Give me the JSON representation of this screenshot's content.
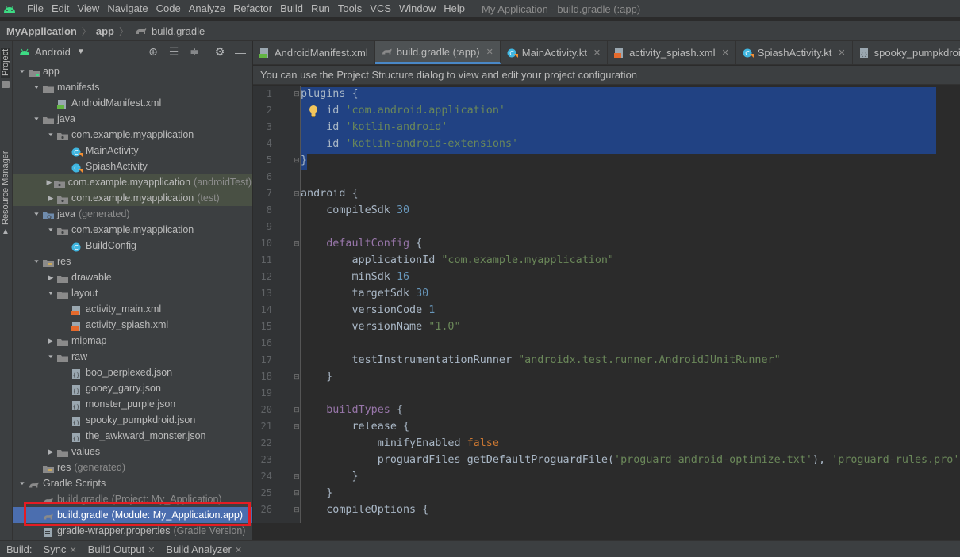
{
  "menubar": {
    "items": [
      "File",
      "Edit",
      "View",
      "Navigate",
      "Code",
      "Analyze",
      "Refactor",
      "Build",
      "Run",
      "Tools",
      "VCS",
      "Window",
      "Help"
    ],
    "window_title": "My Application - build.gradle (:app)"
  },
  "breadcrumb": {
    "project": "MyApplication",
    "module": "app",
    "file": "build.gradle"
  },
  "toolstrip": {
    "project_tab": "Project",
    "resource_manager_tab": "Resource Manager"
  },
  "project_panel": {
    "view_mode": "Android",
    "tree": [
      {
        "label": "app",
        "depth": 0,
        "arrow": "down",
        "icon": "module-folder-icon",
        "bold": false
      },
      {
        "label": "manifests",
        "depth": 1,
        "arrow": "down",
        "icon": "folder-icon"
      },
      {
        "label": "AndroidManifest.xml",
        "depth": 2,
        "arrow": "",
        "icon": "manifest-file-icon"
      },
      {
        "label": "java",
        "depth": 1,
        "arrow": "down",
        "icon": "folder-icon"
      },
      {
        "label": "com.example.myapplication",
        "depth": 2,
        "arrow": "down",
        "icon": "package-icon"
      },
      {
        "label": "MainActivity",
        "depth": 3,
        "arrow": "",
        "icon": "kotlin-class-icon"
      },
      {
        "label": "SpiashActivity",
        "depth": 3,
        "arrow": "",
        "icon": "kotlin-class-icon"
      },
      {
        "label": "com.example.myapplication",
        "sub": "(androidTest)",
        "depth": 2,
        "arrow": "right",
        "icon": "package-icon",
        "style": "hl-green"
      },
      {
        "label": "com.example.myapplication",
        "sub": "(test)",
        "depth": 2,
        "arrow": "right",
        "icon": "package-icon",
        "style": "hl-green"
      },
      {
        "label": "java",
        "sub": "(generated)",
        "depth": 1,
        "arrow": "down",
        "icon": "generated-folder-icon"
      },
      {
        "label": "com.example.myapplication",
        "depth": 2,
        "arrow": "down",
        "icon": "package-icon"
      },
      {
        "label": "BuildConfig",
        "depth": 3,
        "arrow": "",
        "icon": "java-class-icon"
      },
      {
        "label": "res",
        "depth": 1,
        "arrow": "down",
        "icon": "res-folder-icon"
      },
      {
        "label": "drawable",
        "depth": 2,
        "arrow": "right",
        "icon": "folder-icon"
      },
      {
        "label": "layout",
        "depth": 2,
        "arrow": "down",
        "icon": "folder-icon"
      },
      {
        "label": "activity_main.xml",
        "depth": 3,
        "arrow": "",
        "icon": "layout-xml-icon"
      },
      {
        "label": "activity_spiash.xml",
        "depth": 3,
        "arrow": "",
        "icon": "layout-xml-icon"
      },
      {
        "label": "mipmap",
        "depth": 2,
        "arrow": "right",
        "icon": "folder-icon"
      },
      {
        "label": "raw",
        "depth": 2,
        "arrow": "down",
        "icon": "folder-icon"
      },
      {
        "label": "boo_perplexed.json",
        "depth": 3,
        "arrow": "",
        "icon": "json-file-icon"
      },
      {
        "label": "gooey_garry.json",
        "depth": 3,
        "arrow": "",
        "icon": "json-file-icon"
      },
      {
        "label": "monster_purple.json",
        "depth": 3,
        "arrow": "",
        "icon": "json-file-icon"
      },
      {
        "label": "spooky_pumpkdroid.json",
        "depth": 3,
        "arrow": "",
        "icon": "json-file-icon"
      },
      {
        "label": "the_awkward_monster.json",
        "depth": 3,
        "arrow": "",
        "icon": "json-file-icon"
      },
      {
        "label": "values",
        "depth": 2,
        "arrow": "right",
        "icon": "folder-icon"
      },
      {
        "label": "res",
        "sub": "(generated)",
        "depth": 1,
        "arrow": "",
        "icon": "res-folder-icon"
      },
      {
        "label": "Gradle Scripts",
        "depth": 0,
        "arrow": "down",
        "icon": "gradle-icon"
      },
      {
        "label": "build.gradle",
        "sub": "(Project: My_Application)",
        "depth": 1,
        "arrow": "",
        "icon": "gradle-icon",
        "style": "faded"
      },
      {
        "label": "build.gradle",
        "sub": "(Module: My_Application.app)",
        "depth": 1,
        "arrow": "",
        "icon": "gradle-icon",
        "style": "selected"
      },
      {
        "label": "gradle-wrapper.properties",
        "sub": "(Gradle Version)",
        "depth": 1,
        "arrow": "",
        "icon": "properties-file-icon"
      }
    ]
  },
  "editor_tabs": [
    {
      "label": "AndroidManifest.xml",
      "icon": "manifest-file-icon",
      "active": false,
      "close": false
    },
    {
      "label": "build.gradle (:app)",
      "icon": "gradle-icon",
      "active": true,
      "close": true
    },
    {
      "label": "MainActivity.kt",
      "icon": "kotlin-class-icon",
      "active": false,
      "close": true
    },
    {
      "label": "activity_spiash.xml",
      "icon": "layout-xml-icon",
      "active": false,
      "close": true
    },
    {
      "label": "SpiashActivity.kt",
      "icon": "kotlin-class-icon",
      "active": false,
      "close": true
    },
    {
      "label": "spooky_pumpkdroid.json",
      "icon": "json-file-icon",
      "active": false,
      "close": false
    }
  ],
  "notification": "You can use the Project Structure dialog to view and edit your project configuration",
  "code_lines": [
    {
      "n": "1",
      "parts": [
        [
          "plugins {",
          "p"
        ]
      ],
      "fold": "▭"
    },
    {
      "n": "2",
      "parts": [
        [
          "    id ",
          "p"
        ],
        [
          "'com.android.application'",
          "s"
        ]
      ]
    },
    {
      "n": "3",
      "parts": [
        [
          "    id ",
          "p"
        ],
        [
          "'kotlin-android'",
          "s"
        ]
      ]
    },
    {
      "n": "4",
      "parts": [
        [
          "    id ",
          "p"
        ],
        [
          "'kotlin-android-extensions'",
          "s"
        ]
      ]
    },
    {
      "n": "5",
      "parts": [
        [
          "}",
          "p"
        ]
      ],
      "fold": "▭"
    },
    {
      "n": "6",
      "parts": [
        [
          "",
          "p"
        ]
      ]
    },
    {
      "n": "7",
      "parts": [
        [
          "android {",
          "p"
        ]
      ],
      "fold": "▭"
    },
    {
      "n": "8",
      "parts": [
        [
          "    compileSdk ",
          "p"
        ],
        [
          "30",
          "n"
        ]
      ]
    },
    {
      "n": "9",
      "parts": [
        [
          "",
          "p"
        ]
      ]
    },
    {
      "n": "10",
      "parts": [
        [
          "    ",
          "p"
        ],
        [
          "defaultConfig",
          "m"
        ],
        [
          " {",
          "p"
        ]
      ],
      "fold": "▭"
    },
    {
      "n": "11",
      "parts": [
        [
          "        applicationId ",
          "p"
        ],
        [
          "\"com.example.myapplication\"",
          "s"
        ]
      ]
    },
    {
      "n": "12",
      "parts": [
        [
          "        minSdk ",
          "p"
        ],
        [
          "16",
          "n"
        ]
      ]
    },
    {
      "n": "13",
      "parts": [
        [
          "        targetSdk ",
          "p"
        ],
        [
          "30",
          "n"
        ]
      ]
    },
    {
      "n": "14",
      "parts": [
        [
          "        versionCode ",
          "p"
        ],
        [
          "1",
          "n"
        ]
      ]
    },
    {
      "n": "15",
      "parts": [
        [
          "        versionName ",
          "p"
        ],
        [
          "\"1.0\"",
          "s"
        ]
      ]
    },
    {
      "n": "16",
      "parts": [
        [
          "",
          "p"
        ]
      ]
    },
    {
      "n": "17",
      "parts": [
        [
          "        testInstrumentationRunner ",
          "p"
        ],
        [
          "\"androidx.test.runner.AndroidJUnitRunner\"",
          "s"
        ]
      ]
    },
    {
      "n": "18",
      "parts": [
        [
          "    }",
          "p"
        ]
      ],
      "fold": "▭"
    },
    {
      "n": "19",
      "parts": [
        [
          "",
          "p"
        ]
      ]
    },
    {
      "n": "20",
      "parts": [
        [
          "    ",
          "p"
        ],
        [
          "buildTypes",
          "m"
        ],
        [
          " {",
          "p"
        ]
      ],
      "fold": "▭"
    },
    {
      "n": "21",
      "parts": [
        [
          "        release {",
          "p"
        ]
      ],
      "fold": "▭"
    },
    {
      "n": "22",
      "parts": [
        [
          "            minifyEnabled ",
          "p"
        ],
        [
          "false",
          "k"
        ]
      ]
    },
    {
      "n": "23",
      "parts": [
        [
          "            proguardFiles getDefaultProguardFile(",
          "p"
        ],
        [
          "'proguard-android-optimize.txt'",
          "s"
        ],
        [
          "), ",
          "p"
        ],
        [
          "'proguard-rules.pro'",
          "s"
        ]
      ]
    },
    {
      "n": "24",
      "parts": [
        [
          "        }",
          "p"
        ]
      ],
      "fold": "▭"
    },
    {
      "n": "25",
      "parts": [
        [
          "    }",
          "p"
        ]
      ],
      "fold": "▭"
    },
    {
      "n": "26",
      "parts": [
        [
          "    compileOptions {",
          "p"
        ]
      ],
      "fold": "▭"
    }
  ],
  "bottombar": [
    {
      "label": "Build:",
      "close": false
    },
    {
      "label": "Sync",
      "close": true
    },
    {
      "label": "Build Output",
      "close": true
    },
    {
      "label": "Build Analyzer",
      "close": true
    }
  ],
  "colors": {
    "selection": "#214283",
    "selected_row": "#4b6eaf",
    "highlight_box": "#e51c23",
    "string": "#6a8759",
    "number": "#6897bb",
    "keyword": "#cc7832"
  }
}
